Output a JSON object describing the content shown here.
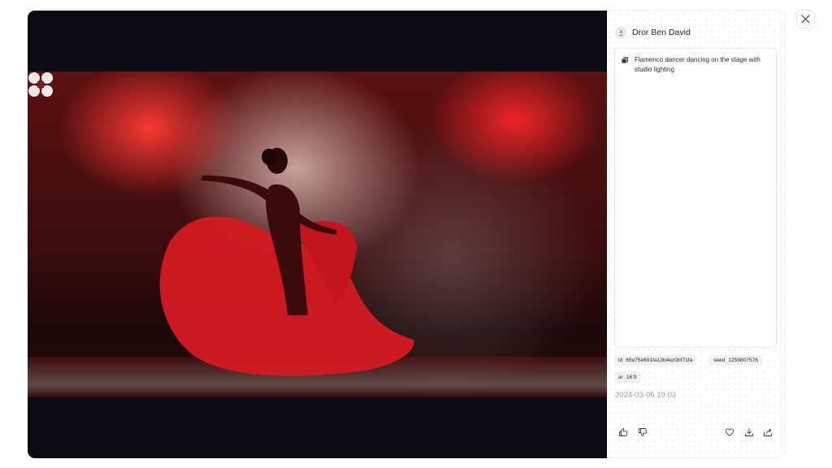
{
  "author": {
    "name": "Dror Ben David"
  },
  "prompt": {
    "text": "Flamenco dancer dancing on the stage with studio lighting"
  },
  "metadata": {
    "id_label": "id",
    "id_value": "65e75e691fa13b4ec0bf71fa",
    "seed_label": "seed",
    "seed_value": "1259807576",
    "ar_label": "ar",
    "ar_value": "16:9"
  },
  "timestamp": "2024-03-05 19:03",
  "actions": [
    "thumbs-up",
    "thumbs-down",
    "heart",
    "download",
    "share"
  ],
  "colors": {
    "viewer_bg": "#0b0a10",
    "accent_red": "#e01b24",
    "muted_text": "#9b9ba3"
  }
}
